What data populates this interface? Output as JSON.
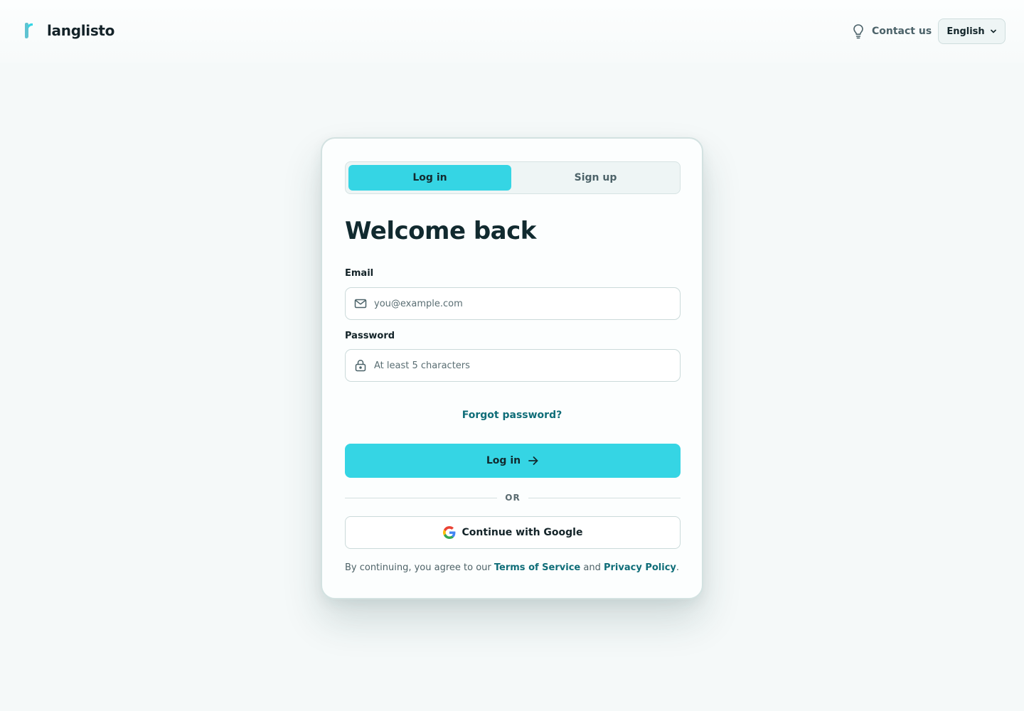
{
  "header": {
    "brand_name": "langlisto",
    "brand_icon": "langlisto-logo-icon",
    "contact_label": "Contact us",
    "contact_icon": "lightbulb-icon",
    "language_label": "English",
    "language_icon": "chevron-down-icon"
  },
  "auth": {
    "tabs": [
      {
        "label": "Log in",
        "active": true
      },
      {
        "label": "Sign up",
        "active": false
      }
    ],
    "heading": "Welcome back",
    "email": {
      "label": "Email",
      "placeholder": "you@example.com",
      "value": "",
      "icon": "mail-icon"
    },
    "password": {
      "label": "Password",
      "placeholder": "At least 5 characters",
      "value": "",
      "icon": "lock-icon"
    },
    "forgot_label": "Forgot password?",
    "submit_label": "Log in",
    "submit_icon": "arrow-right-icon",
    "divider_label": "OR",
    "google_label": "Continue with Google",
    "google_icon": "google-icon",
    "legal": {
      "prefix": "By continuing, you agree to our ",
      "terms_label": "Terms of Service",
      "middle": " and ",
      "privacy_label": "Privacy Policy",
      "suffix": "."
    }
  },
  "colors": {
    "accent": "#35d5e4",
    "link": "#0f6d78",
    "background": "#f5f9f9"
  }
}
